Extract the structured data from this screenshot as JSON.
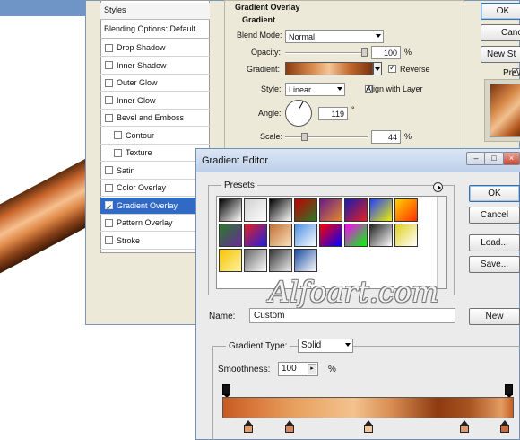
{
  "layer_style": {
    "styles_heading": "Styles",
    "blending_options": "Blending Options: Default",
    "effects": [
      {
        "label": "Drop Shadow",
        "checked": false,
        "sub": false,
        "selected": false
      },
      {
        "label": "Inner Shadow",
        "checked": false,
        "sub": false,
        "selected": false
      },
      {
        "label": "Outer Glow",
        "checked": false,
        "sub": false,
        "selected": false
      },
      {
        "label": "Inner Glow",
        "checked": false,
        "sub": false,
        "selected": false
      },
      {
        "label": "Bevel and Emboss",
        "checked": false,
        "sub": false,
        "selected": false
      },
      {
        "label": "Contour",
        "checked": false,
        "sub": true,
        "selected": false
      },
      {
        "label": "Texture",
        "checked": false,
        "sub": true,
        "selected": false
      },
      {
        "label": "Satin",
        "checked": false,
        "sub": false,
        "selected": false
      },
      {
        "label": "Color Overlay",
        "checked": false,
        "sub": false,
        "selected": false
      },
      {
        "label": "Gradient Overlay",
        "checked": true,
        "sub": false,
        "selected": true
      },
      {
        "label": "Pattern Overlay",
        "checked": false,
        "sub": false,
        "selected": false
      },
      {
        "label": "Stroke",
        "checked": false,
        "sub": false,
        "selected": false
      }
    ],
    "panel_title": "Gradient Overlay",
    "section_title": "Gradient",
    "blend_mode_label": "Blend Mode:",
    "blend_mode_value": "Normal",
    "opacity_label": "Opacity:",
    "opacity_value": "100",
    "opacity_unit": "%",
    "gradient_label": "Gradient:",
    "reverse_label": "Reverse",
    "reverse_checked": true,
    "style_label": "Style:",
    "style_value": "Linear",
    "align_label": "Align with Layer",
    "align_checked": true,
    "angle_label": "Angle:",
    "angle_value": "119",
    "angle_unit": "°",
    "scale_label": "Scale:",
    "scale_value": "44",
    "scale_unit": "%",
    "ok_label": "OK",
    "cancel_label": "Canc",
    "new_style_label": "New St",
    "preview_label": "Prev",
    "preview_checked": true
  },
  "gradient_editor": {
    "title": "Gradient Editor",
    "minimize_icon": "minimize-icon",
    "maximize_icon": "maximize-icon",
    "close_icon": "close-icon",
    "presets_label": "Presets",
    "presets": [
      [
        "#000000",
        "#ffffff"
      ],
      [
        "#d0d0d0",
        "#ffffff"
      ],
      [
        "#000000",
        "#ffffff"
      ],
      [
        "#c00000",
        "#2a7a2a"
      ],
      [
        "#6a1a8a",
        "#e08a2a"
      ],
      [
        "#1a1ab0",
        "#e62020"
      ],
      [
        "#2040ff",
        "#f0f000"
      ],
      [
        "#ffd000",
        "#ff3000"
      ],
      [
        "#2a7a2a",
        "#6a2a9a"
      ],
      [
        "#e02020",
        "#2020e0"
      ],
      [
        "#c07030",
        "#fbe2c0"
      ],
      [
        "#4a90e0",
        "#ffffff"
      ],
      [
        "#ff0000",
        "#0000ff"
      ],
      [
        "#ff00ff",
        "#00ff00"
      ],
      [
        "#222222",
        "#ffffff"
      ],
      [
        "#e0d020",
        "#ffffff"
      ],
      [
        "#f5c400",
        "#fff2a0"
      ],
      [
        "#666666",
        "#ffffff"
      ],
      [
        "#333333",
        "#eeeeee"
      ],
      [
        "#1a4aa0",
        "#ffffff"
      ]
    ],
    "watermark": "Alfoart.com",
    "name_label": "Name:",
    "name_value": "Custom",
    "new_label": "New",
    "ok_label": "OK",
    "cancel_label": "Cancel",
    "load_label": "Load...",
    "save_label": "Save...",
    "gradient_type_label": "Gradient Type:",
    "gradient_type_value": "Solid",
    "smoothness_label": "Smoothness:",
    "smoothness_value": "100",
    "smoothness_unit": "%",
    "color_stops": [
      {
        "location": 0.09,
        "color": "#e49a6a"
      },
      {
        "location": 0.23,
        "color": "#d7855a"
      },
      {
        "location": 0.5,
        "color": "#f0c79e"
      },
      {
        "location": 0.83,
        "color": "#dd9a70"
      },
      {
        "location": 0.97,
        "color": "#c86a3a"
      }
    ],
    "opacity_stops": [
      0.0,
      1.0
    ]
  }
}
